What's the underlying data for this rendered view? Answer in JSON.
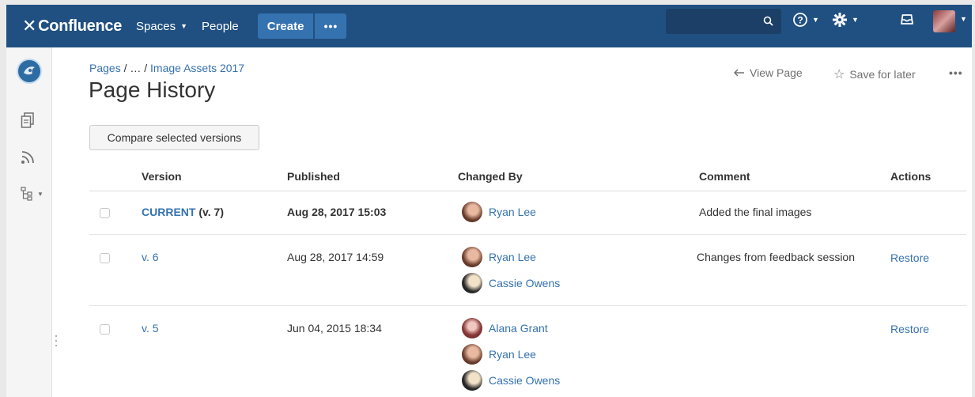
{
  "topnav": {
    "brand": "Confluence",
    "spaces_label": "Spaces",
    "people_label": "People",
    "create_label": "Create",
    "more_label": "•••",
    "search_placeholder": ""
  },
  "breadcrumb": {
    "root": "Pages",
    "ellipsis": "…",
    "current": "Image Assets 2017",
    "separator": "/"
  },
  "page": {
    "title": "Page History",
    "view_page_label": "View Page",
    "save_for_later_label": "Save for later",
    "more_label": "•••"
  },
  "compare_button_label": "Compare selected versions",
  "table": {
    "headers": {
      "version": "Version",
      "published": "Published",
      "changed_by": "Changed By",
      "comment": "Comment",
      "actions": "Actions"
    },
    "rows": [
      {
        "version": "CURRENT",
        "version_suffix": "(v. 7)",
        "published": "Aug 28, 2017 15:03",
        "users": [
          "Ryan Lee"
        ],
        "comment": "Added the final images",
        "action": ""
      },
      {
        "version": "v. 6",
        "published": "Aug 28, 2017 14:59",
        "users": [
          "Ryan Lee",
          "Cassie Owens"
        ],
        "comment": "Changes from feedback session",
        "action": "Restore"
      },
      {
        "version": "v. 5",
        "published": "Jun 04, 2015 18:34",
        "users": [
          "Alana Grant",
          "Ryan Lee",
          "Cassie Owens"
        ],
        "comment": "",
        "action": "Restore"
      }
    ]
  },
  "colors": {
    "nav_bg": "#205081",
    "create_bg": "#3572b0",
    "link": "#3572b0"
  },
  "icons": {
    "logo": "confluence-x-icon",
    "search": "search-icon",
    "help": "help-icon",
    "settings": "gear-icon",
    "notifications": "notifications-icon",
    "sidebar": [
      "pages-icon",
      "blog-icon",
      "page-tree-icon"
    ],
    "view_page": "arrow-left-icon",
    "save_for_later": "star-icon"
  }
}
